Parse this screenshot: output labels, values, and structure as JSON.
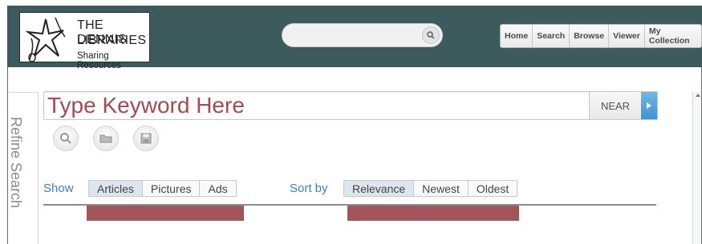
{
  "header": {
    "logo": {
      "line1": "THE DENNIS",
      "line2": "LIBRARIES",
      "line3": "Sharing Resources"
    },
    "search": {
      "placeholder": ""
    },
    "nav": [
      "Home",
      "Search",
      "Browse",
      "Viewer",
      "My Collection"
    ]
  },
  "sidebar": {
    "refine_label": "Refine Search"
  },
  "search_bar": {
    "placeholder": "Type Keyword Here",
    "near_label": "NEAR"
  },
  "tools": [
    "search-icon",
    "folder-icon",
    "save-icon"
  ],
  "filters": {
    "show_label": "Show",
    "show_options": [
      "Articles",
      "Pictures",
      "Ads"
    ],
    "show_active": "Articles",
    "sort_label": "Sort by",
    "sort_options": [
      "Relevance",
      "Newest",
      "Oldest"
    ],
    "sort_active": "Relevance"
  },
  "colors": {
    "header_bg": "#3d5b5c",
    "placeholder_text": "#a44a52",
    "link_blue": "#3f7fbf",
    "redacted_bar": "#a4555b",
    "go_button": "#3f94d3"
  }
}
